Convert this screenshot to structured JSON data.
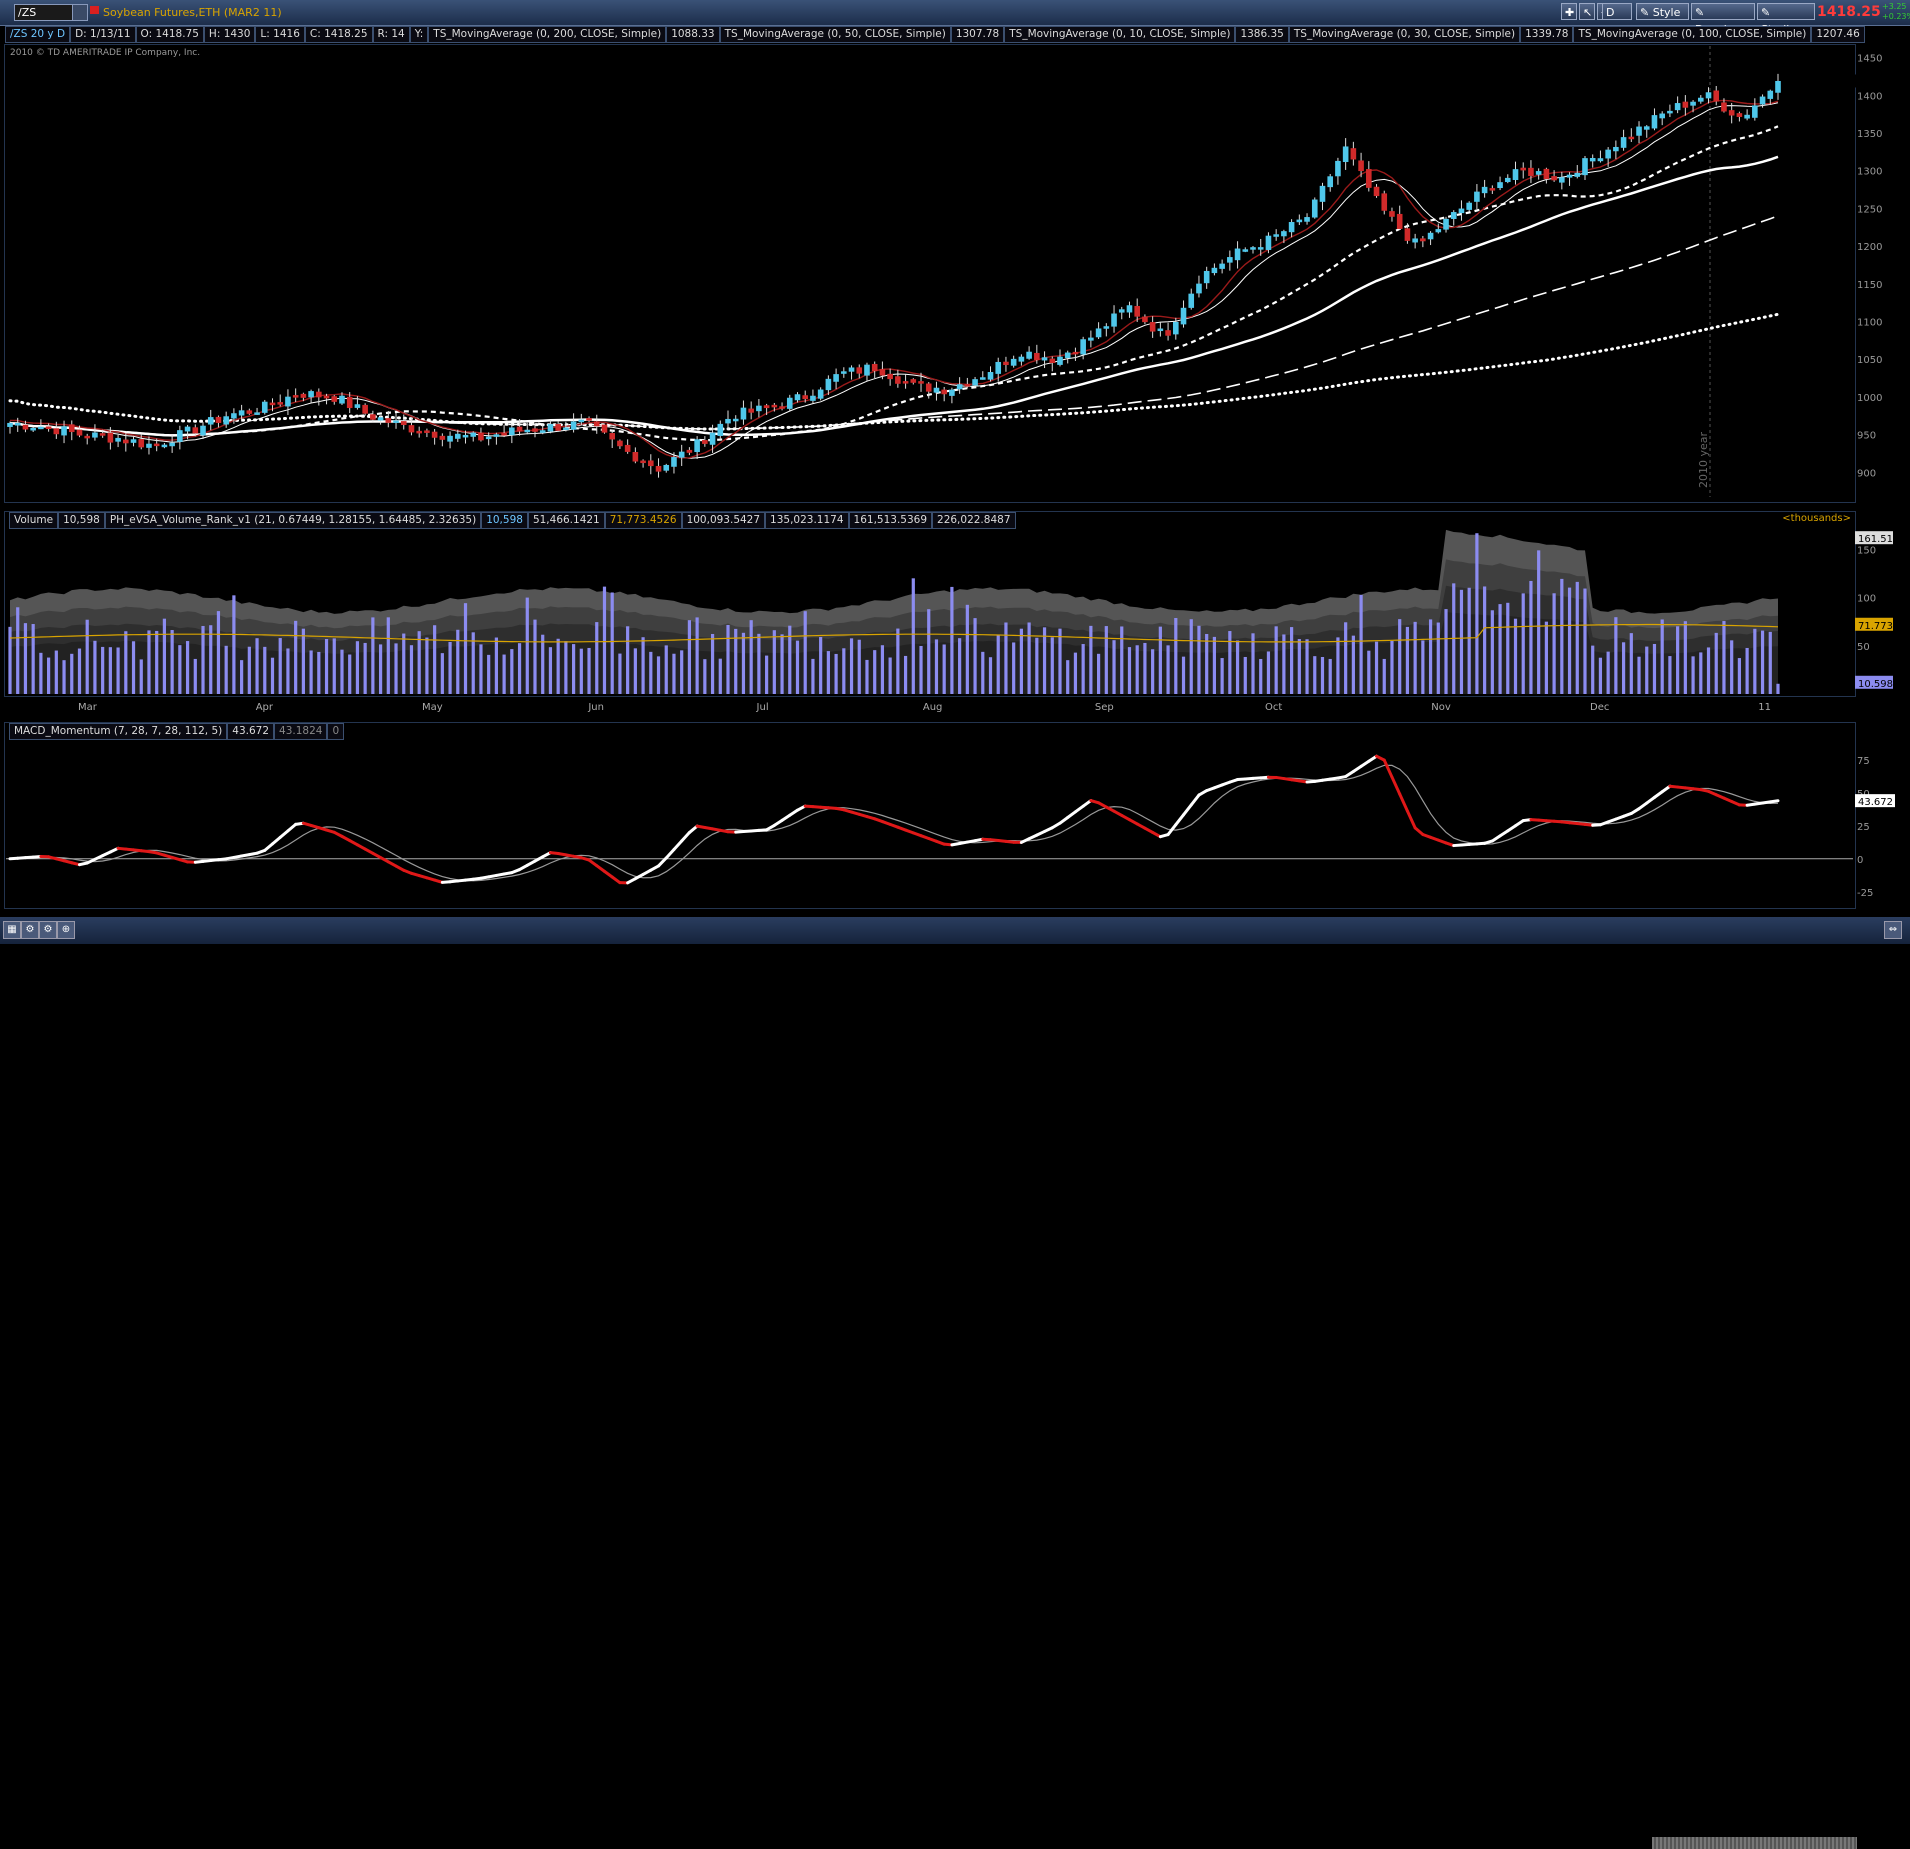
{
  "toolbar": {
    "symbol": "/ZS",
    "description": "Soybean Futures,ETH (MAR2 11)",
    "buttons": [
      "D",
      "Style",
      "Drawings",
      "Studies"
    ],
    "last_price": "1418.25",
    "change_abs": "+3.25",
    "change_pct": "+0.23%"
  },
  "infobar": {
    "items": [
      "/ZS 20 y D",
      "D: 1/13/11",
      "O: 1418.75",
      "H: 1430",
      "L: 1416",
      "C: 1418.25",
      "R: 14",
      "Y:",
      "TS_MovingAverage (0, 200, CLOSE, Simple)",
      "1088.33",
      "TS_MovingAverage (0, 50, CLOSE, Simple)",
      "1307.78",
      "TS_MovingAverage (0, 10, CLOSE, Simple)",
      "1386.35",
      "TS_MovingAverage (0, 30, CLOSE, Simple)",
      "1339.78",
      "TS_MovingAverage (0, 100, CLOSE, Simple)",
      "1207.46"
    ]
  },
  "copyright": "2010 © TD AMERITRADE IP Company, Inc.",
  "year_marker": "2010 year",
  "volume_panel": {
    "items": [
      "Volume",
      "10,598",
      "PH_eVSA_Volume_Rank_v1 (21, 0.67449, 1.28155, 1.64485, 2.32635)",
      "10,598",
      "51,466.1421",
      "71,773.4526",
      "100,093.5427",
      "135,023.1174",
      "161,513.5369",
      "226,022.8487"
    ],
    "units": "<thousands>",
    "axis_ticks": [
      "150",
      "100",
      "50"
    ],
    "tag_top": "161.51",
    "tag_mid": "71.773",
    "tag_bottom": "10.598"
  },
  "months": [
    "Mar",
    "Apr",
    "May",
    "Jun",
    "Jul",
    "Aug",
    "Sep",
    "Oct",
    "Nov",
    "Dec",
    "11"
  ],
  "price_axis": [
    "1450",
    "1400",
    "1350",
    "1300",
    "1250",
    "1200",
    "1150",
    "1100",
    "1050",
    "1000",
    "950",
    "900"
  ],
  "macd_panel": {
    "items": [
      "MACD_Momentum (7, 28, 7, 28, 112, 5)",
      "43.672",
      "43.1824",
      "0"
    ],
    "axis_ticks": [
      "75",
      "50",
      "25",
      "0",
      "-25"
    ],
    "tag": "43.672"
  },
  "colors": {
    "bull": "#4fc7ea",
    "bear": "#d12a2a",
    "volume_bar": "#8c8cf0",
    "orange_line": "#d9a400",
    "accent_red": "#ff3b3b"
  },
  "chart_data": [
    {
      "type": "candlestick",
      "title": "/ZS 20 y D",
      "x_months": [
        "Mar",
        "Apr",
        "May",
        "Jun",
        "Jul",
        "Aug",
        "Sep",
        "Oct",
        "Nov",
        "Dec",
        "11"
      ],
      "ylim": [
        870,
        1460
      ],
      "close_profile": [
        965,
        960,
        950,
        945,
        935,
        955,
        975,
        985,
        1005,
        1000,
        975,
        960,
        950,
        945,
        955,
        960,
        965,
        930,
        905,
        935,
        975,
        985,
        1000,
        1030,
        1040,
        1015,
        1010,
        1030,
        1060,
        1050,
        1080,
        1120,
        1080,
        1160,
        1190,
        1210,
        1240,
        1330,
        1250,
        1200,
        1240,
        1280,
        1300,
        1290,
        1320,
        1350,
        1380,
        1400,
        1370,
        1418
      ],
      "moving_averages": [
        {
          "name": "TS_MovingAverage (0, 10, CLOSE, Simple)",
          "last": 1386.35
        },
        {
          "name": "TS_MovingAverage (0, 30, CLOSE, Simple)",
          "last": 1339.78
        },
        {
          "name": "TS_MovingAverage (0, 50, CLOSE, Simple)",
          "last": 1307.78
        },
        {
          "name": "TS_MovingAverage (0, 100, CLOSE, Simple)",
          "last": 1207.46
        },
        {
          "name": "TS_MovingAverage (0, 200, CLOSE, Simple)",
          "last": 1088.33
        }
      ]
    },
    {
      "type": "bar",
      "title": "Volume",
      "ylim": [
        0,
        170
      ],
      "last": 10.598
    },
    {
      "type": "line",
      "title": "MACD_Momentum (7, 28, 7, 28, 112, 5)",
      "ylim": [
        -35,
        90
      ],
      "values": [
        0,
        2,
        -5,
        8,
        5,
        -3,
        0,
        5,
        28,
        20,
        5,
        -10,
        -18,
        -15,
        -10,
        5,
        0,
        -20,
        -5,
        25,
        20,
        22,
        40,
        38,
        30,
        20,
        10,
        15,
        12,
        25,
        45,
        30,
        15,
        50,
        60,
        62,
        58,
        62,
        80,
        20,
        10,
        12,
        30,
        28,
        25,
        35,
        55,
        52,
        40,
        44
      ],
      "signal_last": 43.1824,
      "last": 43.672
    }
  ]
}
